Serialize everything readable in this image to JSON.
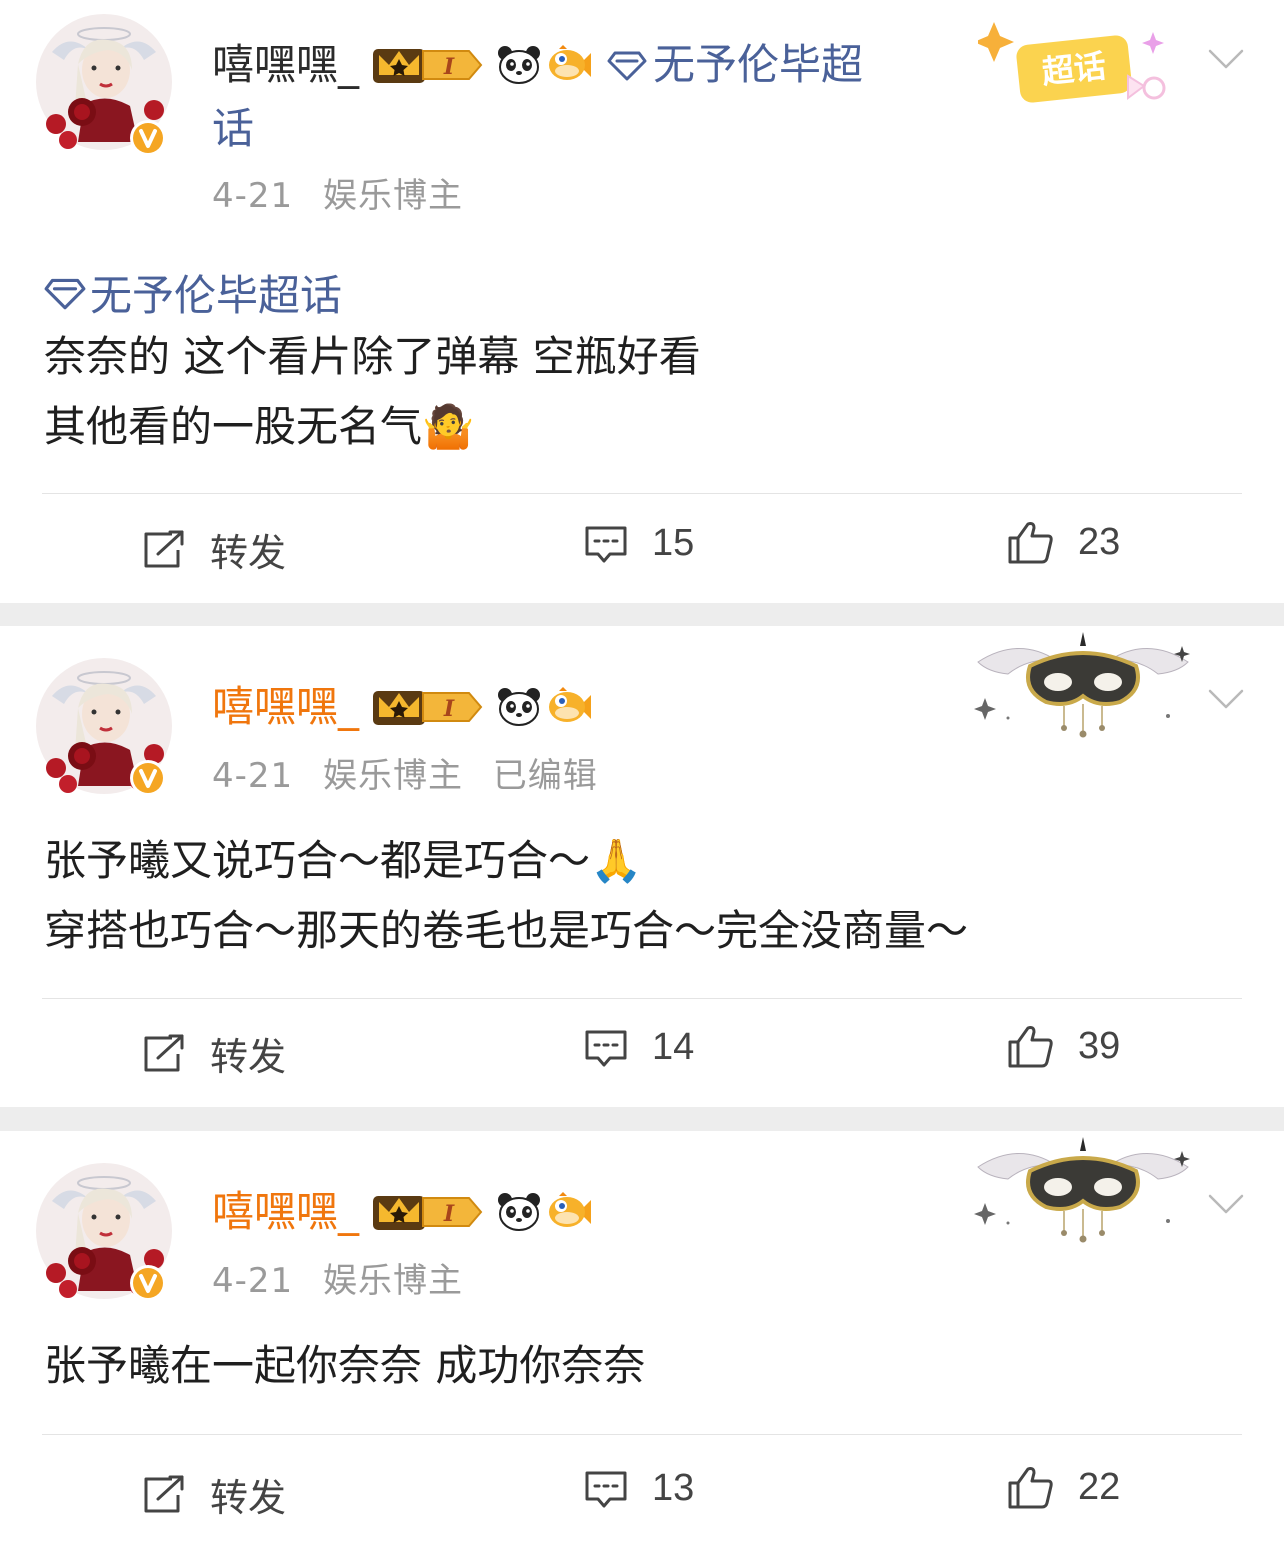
{
  "posts": [
    {
      "username": "嘻嘿嘿_",
      "level_badge": "I",
      "header_topic": "无予伦毕超",
      "header_topic_wrap": "话",
      "date": "4-21",
      "role": "娱乐博主",
      "edited": "",
      "topic_tag": "无予伦毕超话",
      "content_lines": [
        "奈奈的 这个看片除了弹幕 空瓶好看",
        "其他看的一股无名气🤷"
      ],
      "repost_label": "转发",
      "comments": "15",
      "likes": "23",
      "decoration_label": "超话"
    },
    {
      "username": "嘻嘿嘿_",
      "level_badge": "I",
      "date": "4-21",
      "role": "娱乐博主",
      "edited": "已编辑",
      "content_lines": [
        "张予曦又说巧合～都是巧合～🙏",
        "穿搭也巧合～那天的卷毛也是巧合～完全没商量～"
      ],
      "repost_label": "转发",
      "comments": "14",
      "likes": "39"
    },
    {
      "username": "嘻嘿嘿_",
      "level_badge": "I",
      "date": "4-21",
      "role": "娱乐博主",
      "edited": "",
      "content_lines": [
        "张予曦在一起你奈奈 成功你奈奈"
      ],
      "repost_label": "转发",
      "comments": "13",
      "likes": "22"
    }
  ],
  "colors": {
    "username_default": "#2b2b2b",
    "username_vip": "#f0760d",
    "topic_link": "#4a6199",
    "meta_text": "#9a9a9a",
    "verified_badge": "#f5a623"
  },
  "icons": {
    "repost": "repost-icon",
    "comment": "comment-icon",
    "like": "like-icon",
    "more": "chevron-down-icon",
    "topic": "diamond-icon"
  }
}
